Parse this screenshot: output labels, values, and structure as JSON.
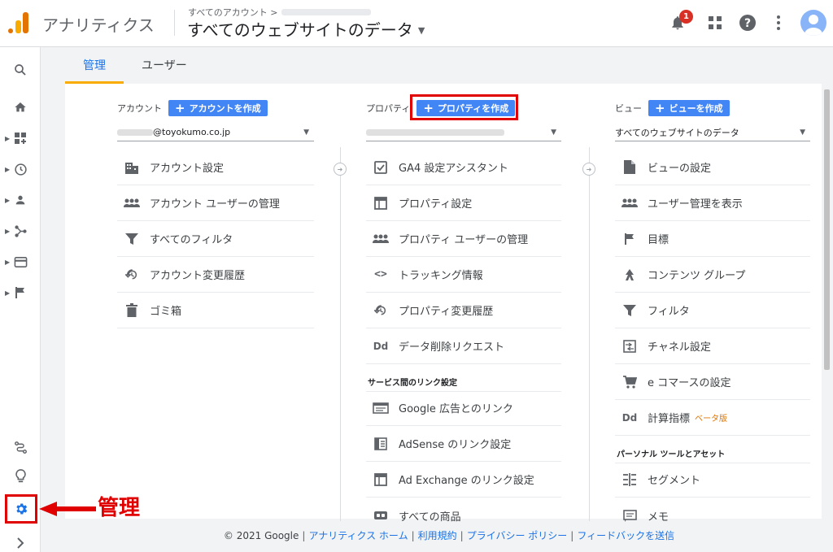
{
  "header": {
    "app_title": "アナリティクス",
    "breadcrumb": "すべてのアカウント >",
    "view_title": "すべてのウェブサイトのデータ",
    "notification_count": "1"
  },
  "tabs": [
    {
      "label": "管理",
      "active": true
    },
    {
      "label": "ユーザー",
      "active": false
    }
  ],
  "account": {
    "label": "アカウント",
    "create_label": "アカウントを作成",
    "email_suffix": "@toyokumo.co.jp",
    "items": [
      {
        "icon": "building-icon",
        "label": "アカウント設定"
      },
      {
        "icon": "people-icon",
        "label": "アカウント ユーザーの管理"
      },
      {
        "icon": "filter-icon",
        "label": "すべてのフィルタ"
      },
      {
        "icon": "history-icon",
        "label": "アカウント変更履歴"
      },
      {
        "icon": "trash-icon",
        "label": "ゴミ箱"
      }
    ]
  },
  "property": {
    "label": "プロパティ",
    "create_label": "プロパティを作成",
    "items": [
      {
        "icon": "checkbox-icon",
        "label": "GA4 設定アシスタント"
      },
      {
        "icon": "window-icon",
        "label": "プロパティ設定"
      },
      {
        "icon": "people-icon",
        "label": "プロパティ ユーザーの管理"
      },
      {
        "icon": "code-icon",
        "label": "トラッキング情報"
      },
      {
        "icon": "history-icon",
        "label": "プロパティ変更履歴"
      },
      {
        "icon": "dd-icon",
        "label": "データ削除リクエスト"
      }
    ],
    "section_title": "サービス間のリンク設定",
    "link_items": [
      {
        "icon": "google-ads-icon",
        "label": "Google 広告とのリンク"
      },
      {
        "icon": "adsense-icon",
        "label": "AdSense のリンク設定"
      },
      {
        "icon": "window-icon",
        "label": "Ad Exchange のリンク設定"
      },
      {
        "icon": "link-icon",
        "label": "すべての商品"
      }
    ]
  },
  "view": {
    "label": "ビュー",
    "create_label": "ビューを作成",
    "selected": "すべてのウェブサイトのデータ",
    "items": [
      {
        "icon": "document-icon",
        "label": "ビューの設定"
      },
      {
        "icon": "people-icon",
        "label": "ユーザー管理を表示"
      },
      {
        "icon": "flag-icon",
        "label": "目標"
      },
      {
        "icon": "content-group-icon",
        "label": "コンテンツ グループ"
      },
      {
        "icon": "filter-icon",
        "label": "フィルタ"
      },
      {
        "icon": "channel-icon",
        "label": "チャネル設定"
      },
      {
        "icon": "cart-icon",
        "label": "e コマースの設定"
      },
      {
        "icon": "dd-icon",
        "label": "計算指標",
        "beta": "ベータ版"
      }
    ],
    "section_title": "パーソナル ツールとアセット",
    "tool_items": [
      {
        "icon": "segment-icon",
        "label": "セグメント"
      },
      {
        "icon": "memo-icon",
        "label": "メモ"
      }
    ]
  },
  "footer": {
    "copyright": "© 2021 Google",
    "links": [
      "アナリティクス ホーム",
      "利用規約",
      "プライバシー ポリシー",
      "フィードバックを送信"
    ]
  },
  "annotation": {
    "label": "管理",
    "color": "#e00000"
  },
  "colors": {
    "accent": "#1a73e8",
    "button": "#4285f4",
    "logo_orange": "#e37400",
    "logo_yellow": "#f9ab00"
  }
}
